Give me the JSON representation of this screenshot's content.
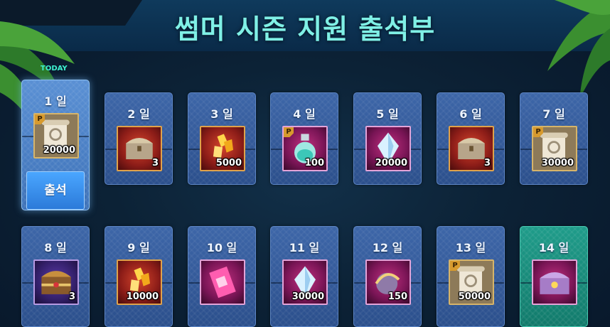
{
  "header": {
    "title": "썸머 시즌 지원 출석부"
  },
  "today_label": "TODAY",
  "attend_button_label": "출석",
  "days": [
    {
      "label": "1 일",
      "reward": "scroll-icon",
      "qty": "20000",
      "premium": true,
      "state": "today"
    },
    {
      "label": "2 일",
      "reward": "chest-icon",
      "qty": "3",
      "premium": false,
      "state": "normal"
    },
    {
      "label": "3 일",
      "reward": "gold-crystal-icon",
      "qty": "5000",
      "premium": false,
      "state": "normal"
    },
    {
      "label": "4 일",
      "reward": "potion-icon",
      "qty": "100",
      "premium": true,
      "state": "normal"
    },
    {
      "label": "5 일",
      "reward": "diamond-icon",
      "qty": "20000",
      "premium": false,
      "state": "normal"
    },
    {
      "label": "6 일",
      "reward": "chest-icon",
      "qty": "3",
      "premium": false,
      "state": "normal"
    },
    {
      "label": "7 일",
      "reward": "scroll-icon",
      "qty": "30000",
      "premium": true,
      "state": "normal"
    },
    {
      "label": "8 일",
      "reward": "ornate-chest-icon",
      "qty": "3",
      "premium": false,
      "state": "normal"
    },
    {
      "label": "9 일",
      "reward": "gold-crystal-icon",
      "qty": "10000",
      "premium": false,
      "state": "normal"
    },
    {
      "label": "10 일",
      "reward": "magic-scroll-icon",
      "qty": "",
      "premium": false,
      "state": "normal"
    },
    {
      "label": "11 일",
      "reward": "diamond-icon",
      "qty": "30000",
      "premium": false,
      "state": "normal"
    },
    {
      "label": "12 일",
      "reward": "orb-icon",
      "qty": "150",
      "premium": false,
      "state": "normal"
    },
    {
      "label": "13 일",
      "reward": "scroll-icon",
      "qty": "50000",
      "premium": true,
      "state": "normal"
    },
    {
      "label": "14 일",
      "reward": "treasure-chest-icon",
      "qty": "",
      "premium": false,
      "state": "final"
    }
  ],
  "colors": {
    "title": "#7ff0e6",
    "today_tag": "#3ef0d0",
    "card": "#3d66a8",
    "card_today": "#5a90d4",
    "card_final": "#1f9c8a",
    "button": "#2b7ad9"
  }
}
